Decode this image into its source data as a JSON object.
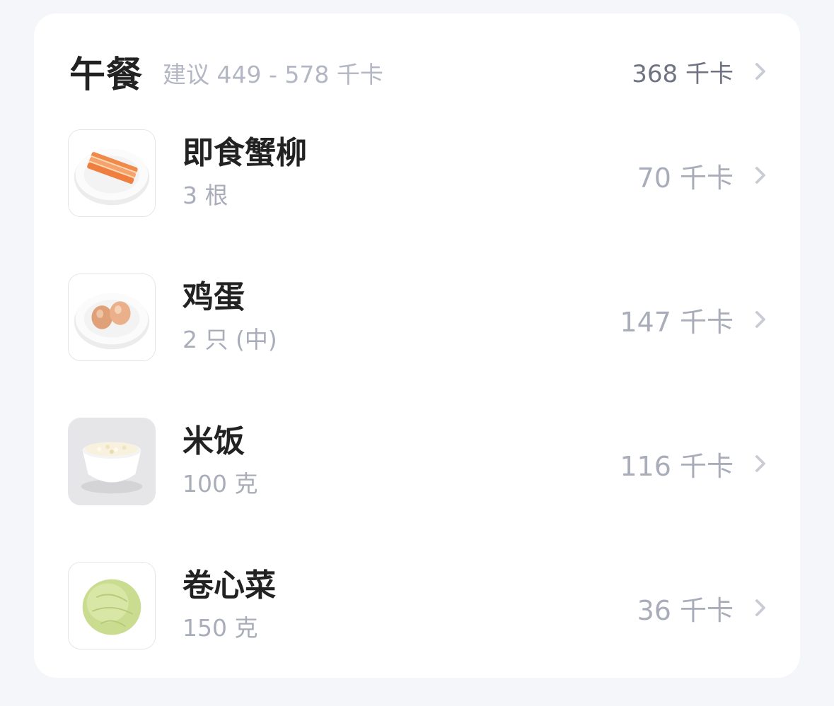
{
  "meal": {
    "title": "午餐",
    "suggestion": "建议 449 - 578 千卡",
    "total": "368 千卡"
  },
  "foods": [
    {
      "name": "即食蟹柳",
      "portion": "3 根",
      "kcal": "70 千卡",
      "icon": "crab-stick-plate-icon"
    },
    {
      "name": "鸡蛋",
      "portion": "2 只 (中)",
      "kcal": "147 千卡",
      "icon": "eggs-plate-icon"
    },
    {
      "name": "米饭",
      "portion": "100 克",
      "kcal": "116 千卡",
      "icon": "rice-bowl-icon"
    },
    {
      "name": "卷心菜",
      "portion": "150 克",
      "kcal": "36 千卡",
      "icon": "cabbage-icon"
    }
  ]
}
